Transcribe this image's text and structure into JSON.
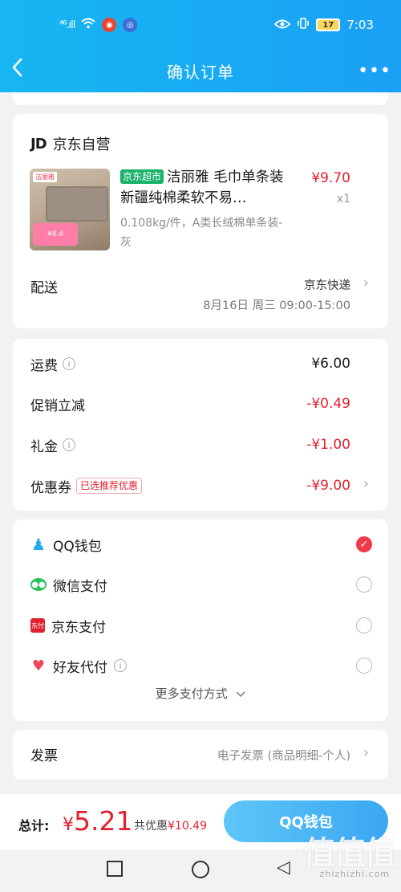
{
  "status_bar": {
    "signal": "⁴⁶.ıll",
    "time": "7:03",
    "battery": "17"
  },
  "header": {
    "title": "确认订单",
    "more": "•••"
  },
  "shop": {
    "logo": "JD",
    "name": "京东自营"
  },
  "product": {
    "tag": "京东超市",
    "title": "洁丽雅 毛巾单条装新疆纯棉柔软不易…",
    "spec": "0.108kg/件，A类长绒棉单条装-灰",
    "price": "¥9.70",
    "qty": "x1",
    "thumb_brand": "洁丽雅",
    "thumb_price": "¥8.4"
  },
  "delivery": {
    "label": "配送",
    "carrier": "京东快递",
    "time": "8月16日 周三 09:00-15:00"
  },
  "fees": {
    "freight_label": "运费",
    "freight_value": "¥6.00",
    "promo_label": "促销立减",
    "promo_value": "-¥0.49",
    "gift_label": "礼金",
    "gift_value": "-¥1.00",
    "coupon_label": "优惠券",
    "coupon_pill": "已选推荐优惠",
    "coupon_value": "-¥9.00"
  },
  "payment": {
    "options": [
      {
        "label": "QQ钱包",
        "selected": true
      },
      {
        "label": "微信支付",
        "selected": false
      },
      {
        "label": "京东支付",
        "selected": false
      },
      {
        "label": "好友代付",
        "selected": false
      }
    ],
    "more": "更多支付方式"
  },
  "invoice": {
    "label": "发票",
    "value": "电子发票 (商品明细-个人)"
  },
  "footer": {
    "total_label": "总计:",
    "currency": "¥",
    "total": "5.21",
    "save_label": "共优惠",
    "save_value": "¥10.49",
    "pay_button": "QQ钱包"
  },
  "watermark": {
    "main": "值值值",
    "sub": "zhizhizhi.com"
  },
  "colors": {
    "header_blue": "#1aa0f5",
    "price_red": "#e3202e",
    "jd_green": "#18b26a"
  }
}
